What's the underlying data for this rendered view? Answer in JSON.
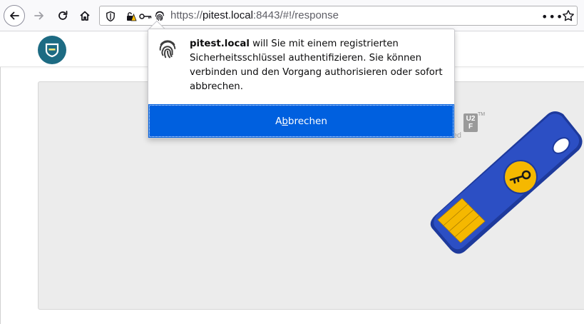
{
  "browser": {
    "url_scheme": "https://",
    "url_host": "pitest.local",
    "url_rest": ":8443/#!/response",
    "more_label": "•••",
    "icons": {
      "back": "arrow-left-icon",
      "forward": "arrow-right-icon",
      "reload": "reload-icon",
      "home": "home-icon",
      "tracking": "shield-icon",
      "insecure": "lock-warning-icon",
      "key": "key-icon",
      "fingerprint": "fingerprint-icon",
      "bookmark": "star-icon"
    }
  },
  "page": {
    "badge_text_top": "U2",
    "badge_text_bottom": "F",
    "trademark": "TM",
    "certified_label": "Certified",
    "colors": {
      "logo": "#1d6b83",
      "key_body": "#2446b0",
      "key_contacts": "#f5b800"
    }
  },
  "popup": {
    "site": "pitest.local",
    "message": " will Sie mit einem registrierten Sicherheitsschlüssel authentifizieren. Sie können verbinden und den Vorgang authorisieren oder sofort abbrechen.",
    "button_pre": "A",
    "button_accesskey": "b",
    "button_post": "brechen",
    "button_color": "#0060df"
  }
}
